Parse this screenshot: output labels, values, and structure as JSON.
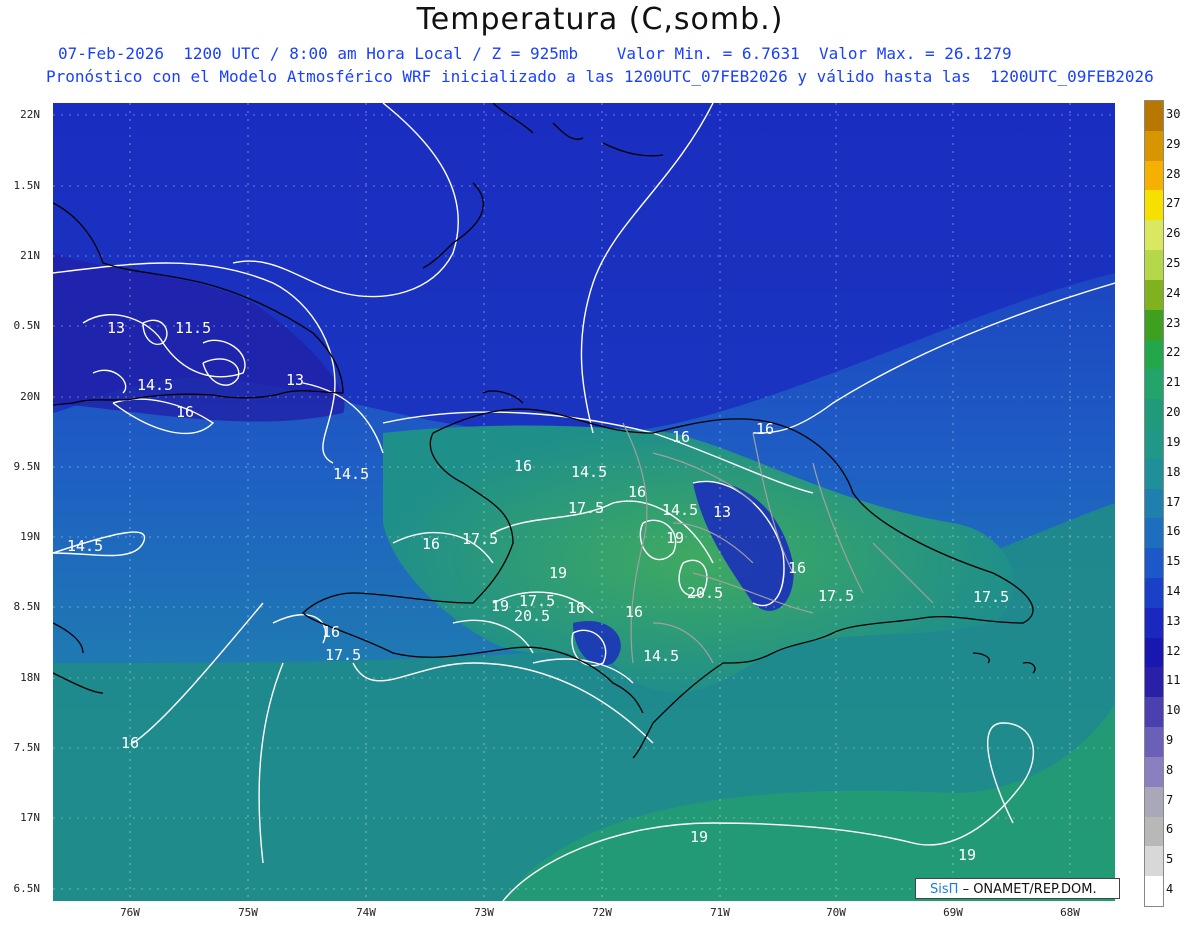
{
  "title": "Temperatura (C,somb.)",
  "subtitle_line1": "07-Feb-2026  1200 UTC / 8:00 am Hora Local / Z = 925mb    Valor Min. = 6.7631  Valor Max. = 26.1279",
  "subtitle_line2": "Pronóstico con el Modelo Atmosférico WRF inicializado a las 1200UTC_07FEB2026 y válido hasta las  1200UTC_09FEB2026",
  "lat_labels": [
    "22N",
    "1.5N",
    "21N",
    "0.5N",
    "20N",
    "9.5N",
    "19N",
    "8.5N",
    "18N",
    "7.5N",
    "17N",
    "6.5N"
  ],
  "lon_labels": [
    "76W",
    "75W",
    "74W",
    "73W",
    "72W",
    "71W",
    "70W",
    "69W",
    "68W"
  ],
  "colorbar": {
    "labels": [
      "30",
      "29",
      "28",
      "27",
      "26",
      "25",
      "24",
      "23",
      "22",
      "21",
      "20",
      "19",
      "18",
      "17",
      "16",
      "15",
      "14",
      "13",
      "12",
      "11",
      "10",
      "9",
      "8",
      "7",
      "6",
      "5",
      "4"
    ],
    "colors": [
      "#b87800",
      "#d99500",
      "#f5b000",
      "#f5e000",
      "#d9e860",
      "#b5d84a",
      "#7fb21e",
      "#3fa020",
      "#22a84a",
      "#23a46a",
      "#1f9a7a",
      "#209888",
      "#1f8f9a",
      "#1f80b0",
      "#1e6ec0",
      "#1c58c8",
      "#1a40c8",
      "#1a28c0",
      "#1818b0",
      "#2a20a8",
      "#4a40b0",
      "#6a60b8",
      "#8a80c0",
      "#a8a8b8",
      "#b8b8b8",
      "#d8d8d8",
      "#ffffff"
    ]
  },
  "contour_labels": [
    "13",
    "11.5",
    "14.5",
    "16",
    "13",
    "14.5",
    "16",
    "14.5",
    "16",
    "16",
    "16",
    "14.5",
    "13",
    "17.5",
    "19",
    "17.5",
    "16",
    "19",
    "20.5",
    "16",
    "17.5",
    "19",
    "20.5",
    "17.5",
    "16",
    "14.5",
    "16",
    "17.5",
    "17.5",
    "16",
    "19",
    "19",
    "14.5",
    "16"
  ],
  "credit": {
    "brand": "SisΠ",
    "org": "– ONAMET/REP.DOM."
  },
  "colors": {
    "ocean_dark": "#1a2ec0",
    "ocean_mid": "#1f5fc0",
    "sea_green": "#1f9080",
    "land_green": "#2a9a6a",
    "contour": "#ffffff",
    "coast": "#000000",
    "border": "#a0a0a0",
    "subtitle": "#1a40ff"
  }
}
